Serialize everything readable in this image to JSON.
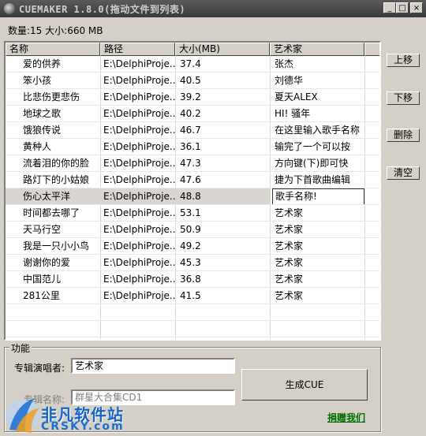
{
  "window": {
    "title": "CUEMAKER 1.8.0(拖动文件到列表)",
    "minimize": "_",
    "maximize": "□",
    "close": "×"
  },
  "stats": {
    "count": "数量:15",
    "size": "大小:660 MB"
  },
  "list": {
    "columns": [
      "名称",
      "路径",
      "大小(MB)",
      "艺术家"
    ],
    "rows": [
      {
        "name": "爱的供养",
        "path": "E:\\DelphiProje...",
        "size": "37.4",
        "artist": "张杰"
      },
      {
        "name": "笨小孩",
        "path": "E:\\DelphiProje...",
        "size": "40.5",
        "artist": "刘德华"
      },
      {
        "name": "比悲伤更悲伤",
        "path": "E:\\DelphiProje...",
        "size": "39.2",
        "artist": "夏天ALEX"
      },
      {
        "name": "地球之歌",
        "path": "E:\\DelphiProje...",
        "size": "40.2",
        "artist": "HI! 骚年"
      },
      {
        "name": "饿狼传说",
        "path": "E:\\DelphiProje...",
        "size": "46.7",
        "artist": "在这里输入歌手名称"
      },
      {
        "name": "黄种人",
        "path": "E:\\DelphiProje...",
        "size": "36.1",
        "artist": "输完了一个可以按"
      },
      {
        "name": "流着泪的你的脸",
        "path": "E:\\DelphiProje...",
        "size": "47.3",
        "artist": "方向键(下)即可快"
      },
      {
        "name": "路灯下的小姑娘",
        "path": "E:\\DelphiProje...",
        "size": "47.6",
        "artist": "捷为下首歌曲编辑"
      },
      {
        "name": "伤心太平洋",
        "path": "E:\\DelphiProje...",
        "size": "48.8",
        "artist": "歌手名称!"
      },
      {
        "name": "时间都去哪了",
        "path": "E:\\DelphiProje...",
        "size": "53.1",
        "artist": "艺术家"
      },
      {
        "name": "天马行空",
        "path": "E:\\DelphiProje...",
        "size": "50.9",
        "artist": "艺术家"
      },
      {
        "name": "我是一只小小鸟",
        "path": "E:\\DelphiProje...",
        "size": "49.2",
        "artist": "艺术家"
      },
      {
        "name": "谢谢你的爱",
        "path": "E:\\DelphiProje...",
        "size": "45.3",
        "artist": "艺术家"
      },
      {
        "name": "中国范儿",
        "path": "E:\\DelphiProje...",
        "size": "36.8",
        "artist": "艺术家"
      },
      {
        "name": "281公里",
        "path": "E:\\DelphiProje...",
        "size": "41.5",
        "artist": "艺术家"
      }
    ]
  },
  "side_buttons": {
    "up": "上移",
    "down": "下移",
    "delete": "删除",
    "clear": "清空"
  },
  "function_group": {
    "label": "功能",
    "artist_label": "专辑演唱者:",
    "artist_value": "艺术家",
    "album_label": "专辑名称:",
    "album_value": "群星大合集CD1",
    "generate": "生成CUE",
    "donate": "捐赠我们"
  },
  "watermark": {
    "line1": "非凡软件站",
    "line2": "CRSKY.com"
  }
}
